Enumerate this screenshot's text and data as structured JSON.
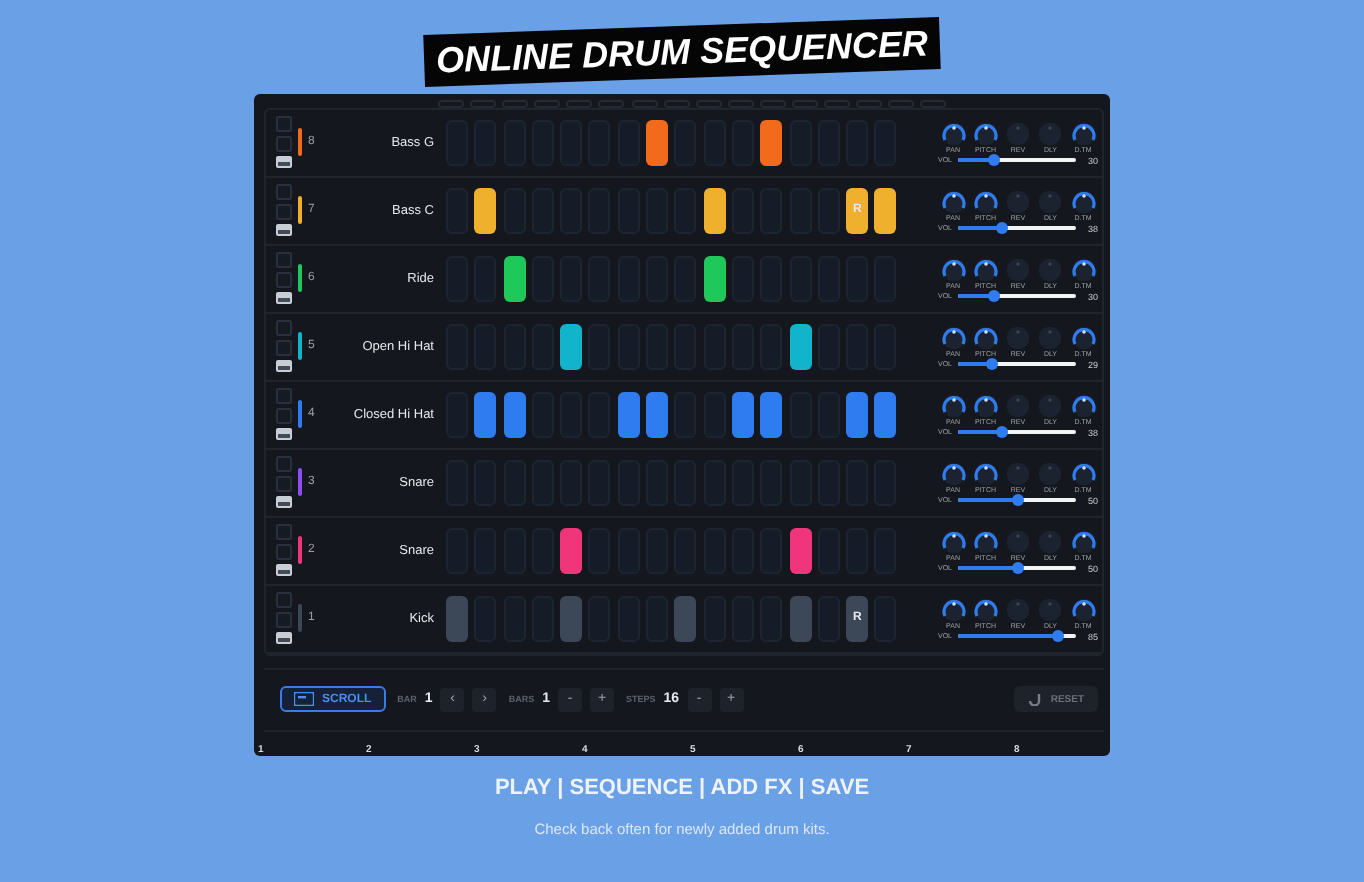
{
  "title": "ONLINE DRUM SEQUENCER",
  "tracks": [
    {
      "number": "8",
      "name": "Bass G",
      "color": "#f26b1d",
      "vol_label": "VOL",
      "level": 0.3,
      "reading": "30",
      "pads": [
        {
          "on": false
        },
        {
          "on": false
        },
        {
          "on": false
        },
        {
          "on": false
        },
        {
          "on": false
        },
        {
          "on": false
        },
        {
          "on": false
        },
        {
          "on": true
        },
        {
          "on": false
        },
        {
          "on": false
        },
        {
          "on": false
        },
        {
          "on": true
        },
        {
          "on": false
        },
        {
          "on": false
        },
        {
          "on": false
        },
        {
          "on": false
        }
      ],
      "knobs": [
        {
          "label": "PAN",
          "on": true
        },
        {
          "label": "PITCH",
          "on": true
        },
        {
          "label": "REV",
          "on": false
        },
        {
          "label": "DLY",
          "on": false
        },
        {
          "label": "D.TM",
          "on": true
        }
      ]
    },
    {
      "number": "7",
      "name": "Bass C",
      "color": "#efb02e",
      "vol_label": "VOL",
      "level": 0.38,
      "reading": "38",
      "pads": [
        {
          "on": false
        },
        {
          "on": true
        },
        {
          "on": false
        },
        {
          "on": false
        },
        {
          "on": false
        },
        {
          "on": false
        },
        {
          "on": false
        },
        {
          "on": false
        },
        {
          "on": false
        },
        {
          "on": true
        },
        {
          "on": false
        },
        {
          "on": false
        },
        {
          "on": false
        },
        {
          "on": false
        },
        {
          "on": true,
          "text": "R"
        },
        {
          "on": true
        }
      ],
      "knobs": [
        {
          "label": "PAN",
          "on": true
        },
        {
          "label": "PITCH",
          "on": true
        },
        {
          "label": "REV",
          "on": false
        },
        {
          "label": "DLY",
          "on": false
        },
        {
          "label": "D.TM",
          "on": true
        }
      ]
    },
    {
      "number": "6",
      "name": "Ride",
      "color": "#1ec85a",
      "vol_label": "VOL",
      "level": 0.3,
      "reading": "30",
      "pads": [
        {
          "on": false
        },
        {
          "on": false
        },
        {
          "on": true
        },
        {
          "on": false
        },
        {
          "on": false
        },
        {
          "on": false
        },
        {
          "on": false
        },
        {
          "on": false
        },
        {
          "on": false
        },
        {
          "on": true
        },
        {
          "on": false
        },
        {
          "on": false
        },
        {
          "on": false
        },
        {
          "on": false
        },
        {
          "on": false
        },
        {
          "on": false
        }
      ],
      "knobs": [
        {
          "label": "PAN",
          "on": true
        },
        {
          "label": "PITCH",
          "on": true
        },
        {
          "label": "REV",
          "on": false
        },
        {
          "label": "DLY",
          "on": false
        },
        {
          "label": "D.TM",
          "on": true
        }
      ]
    },
    {
      "number": "5",
      "name": "Open Hi Hat",
      "color": "#12b4cc",
      "vol_label": "VOL",
      "level": 0.29,
      "reading": "29",
      "pads": [
        {
          "on": false
        },
        {
          "on": false
        },
        {
          "on": false
        },
        {
          "on": false
        },
        {
          "on": true
        },
        {
          "on": false
        },
        {
          "on": false
        },
        {
          "on": false
        },
        {
          "on": false
        },
        {
          "on": false
        },
        {
          "on": false
        },
        {
          "on": false
        },
        {
          "on": true
        },
        {
          "on": false
        },
        {
          "on": false
        },
        {
          "on": false
        }
      ],
      "knobs": [
        {
          "label": "PAN",
          "on": true
        },
        {
          "label": "PITCH",
          "on": true
        },
        {
          "label": "REV",
          "on": false
        },
        {
          "label": "DLY",
          "on": false
        },
        {
          "label": "D.TM",
          "on": true
        }
      ]
    },
    {
      "number": "4",
      "name": "Closed Hi Hat",
      "color": "#2f7cf0",
      "vol_label": "VOL",
      "level": 0.38,
      "reading": "38",
      "pads": [
        {
          "on": false
        },
        {
          "on": true
        },
        {
          "on": true
        },
        {
          "on": false
        },
        {
          "on": false
        },
        {
          "on": false
        },
        {
          "on": true
        },
        {
          "on": true
        },
        {
          "on": false
        },
        {
          "on": false
        },
        {
          "on": true
        },
        {
          "on": true
        },
        {
          "on": false
        },
        {
          "on": false
        },
        {
          "on": true
        },
        {
          "on": true
        }
      ],
      "knobs": [
        {
          "label": "PAN",
          "on": true
        },
        {
          "label": "PITCH",
          "on": true
        },
        {
          "label": "REV",
          "on": false
        },
        {
          "label": "DLY",
          "on": false
        },
        {
          "label": "D.TM",
          "on": true
        }
      ]
    },
    {
      "number": "3",
      "name": "Snare",
      "color": "#8b4ff0",
      "vol_label": "VOL",
      "level": 0.5,
      "reading": "50",
      "pads": [
        {
          "on": false
        },
        {
          "on": false
        },
        {
          "on": false
        },
        {
          "on": false
        },
        {
          "on": false
        },
        {
          "on": false
        },
        {
          "on": false
        },
        {
          "on": false
        },
        {
          "on": false
        },
        {
          "on": false
        },
        {
          "on": false
        },
        {
          "on": false
        },
        {
          "on": false
        },
        {
          "on": false
        },
        {
          "on": false
        },
        {
          "on": false
        }
      ],
      "knobs": [
        {
          "label": "PAN",
          "on": true
        },
        {
          "label": "PITCH",
          "on": true
        },
        {
          "label": "REV",
          "on": false
        },
        {
          "label": "DLY",
          "on": false
        },
        {
          "label": "D.TM",
          "on": true
        }
      ]
    },
    {
      "number": "2",
      "name": "Snare",
      "color": "#f0357a",
      "vol_label": "VOL",
      "level": 0.5,
      "reading": "50",
      "pads": [
        {
          "on": false
        },
        {
          "on": false
        },
        {
          "on": false
        },
        {
          "on": false
        },
        {
          "on": true
        },
        {
          "on": false
        },
        {
          "on": false
        },
        {
          "on": false
        },
        {
          "on": false
        },
        {
          "on": false
        },
        {
          "on": false
        },
        {
          "on": false
        },
        {
          "on": true
        },
        {
          "on": false
        },
        {
          "on": false
        },
        {
          "on": false
        }
      ],
      "knobs": [
        {
          "label": "PAN",
          "on": true
        },
        {
          "label": "PITCH",
          "on": true
        },
        {
          "label": "REV",
          "on": false
        },
        {
          "label": "DLY",
          "on": false
        },
        {
          "label": "D.TM",
          "on": true
        }
      ]
    },
    {
      "number": "1",
      "name": "Kick",
      "color": "#3c4758",
      "vol_label": "VOL",
      "level": 0.85,
      "reading": "85",
      "pads": [
        {
          "on": true
        },
        {
          "on": false
        },
        {
          "on": false
        },
        {
          "on": false
        },
        {
          "on": true
        },
        {
          "on": false
        },
        {
          "on": false
        },
        {
          "on": false
        },
        {
          "on": true
        },
        {
          "on": false
        },
        {
          "on": false
        },
        {
          "on": false
        },
        {
          "on": true
        },
        {
          "on": false
        },
        {
          "on": true,
          "text": "R"
        },
        {
          "on": false
        }
      ],
      "knobs": [
        {
          "label": "PAN",
          "on": true
        },
        {
          "label": "PITCH",
          "on": true
        },
        {
          "label": "REV",
          "on": false
        },
        {
          "label": "DLY",
          "on": false
        },
        {
          "label": "D.TM",
          "on": true
        }
      ]
    }
  ],
  "controls": {
    "scroll": {
      "label": "SCROLL",
      "selected": true
    },
    "bar_label": "BAR",
    "bar": "1",
    "prev": "‹",
    "next": "›",
    "bars_label": "BARS",
    "bars": "1",
    "bars_minus": "-",
    "bars_plus": "+",
    "steps_label": "STEPS",
    "steps": "16",
    "steps_minus": "-",
    "steps_plus": "+",
    "reset": {
      "label": "RESET",
      "disabled": true
    }
  },
  "ruler": [
    "1",
    "2",
    "3",
    "4",
    "5",
    "6",
    "7",
    "8"
  ],
  "menu": "PLAY | SEQUENCE | ADD FX | SAVE",
  "note": "Check back often for newly added drum kits."
}
